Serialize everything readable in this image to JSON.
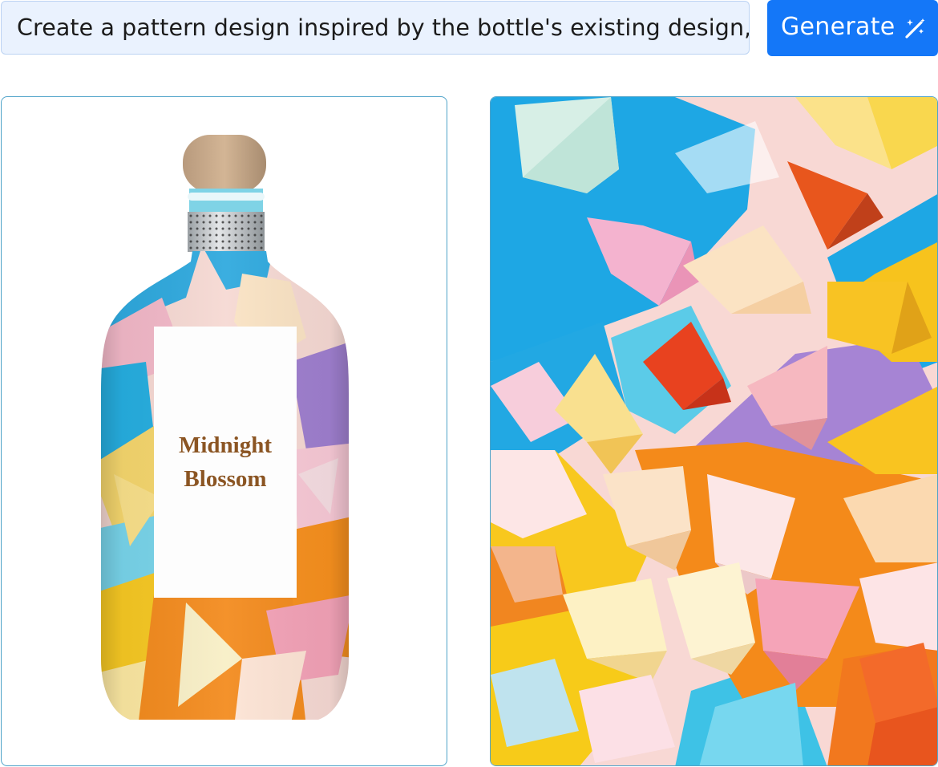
{
  "prompt": {
    "value": "Create a pattern design inspired by the bottle's existing design,"
  },
  "generate_button": {
    "label": "Generate",
    "icon": "magic-wand-icon"
  },
  "preview": {
    "bottle_label_line1": "Midnight",
    "bottle_label_line2": "Blossom"
  },
  "colors": {
    "accent": "#1477f8",
    "prompt_bg": "#eaf2fe",
    "panel_border": "#4fa3c9",
    "label_text": "#8b5523"
  }
}
